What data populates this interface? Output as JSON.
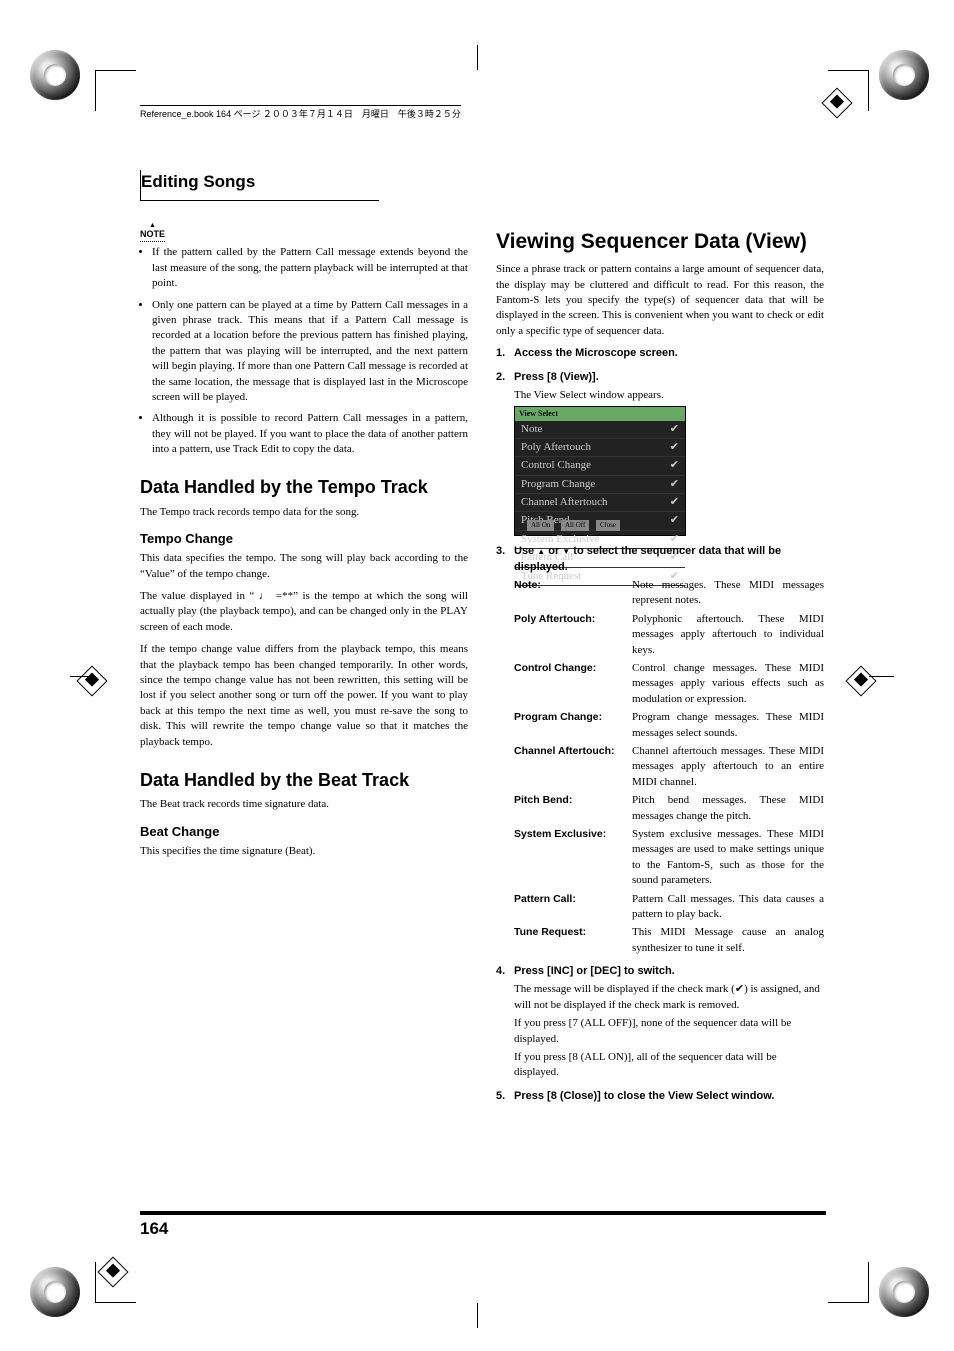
{
  "hint_top": "Reference_e.book  164 ページ  ２００３年７月１４日　月曜日　午後３時２５分",
  "header": {
    "title": "Editing Songs"
  },
  "left": {
    "note_label": "NOTE",
    "bullets": [
      "If the pattern called by the Pattern Call message extends beyond the last measure of the song, the pattern playback will be interrupted at that point.",
      "Only one pattern can be played at a time by Pattern Call messages in a given phrase track. This means that if a Pattern Call message is recorded at a location before the previous pattern has finished playing, the pattern that was playing will be interrupted, and the next pattern will begin playing. If more than one Pattern Call message is recorded at the same location, the message that is displayed last in the Microscope screen will be played.",
      "Although it is possible to record Pattern Call messages in a pattern, they will not be played. If you want to place the data of another pattern into a pattern, use Track Edit to copy the data."
    ],
    "h2a": "Data Handled by the Tempo Track",
    "p_a": "The Tempo track records tempo data for the song.",
    "h3a": "Tempo Change",
    "p_b": "This data specifies the tempo. The song will play back according to the “Value” of the tempo change.",
    "p_c1": "The value displayed in “ ",
    "p_c2": " =**” is the tempo at which the song will actually play (the playback tempo), and can be changed only in the PLAY screen of each mode.",
    "p_d": "If the tempo change value differs from the playback tempo, this means that the playback tempo has been changed temporarily. In other words, since the tempo change value has not been rewritten, this setting will be lost if you select another song or turn off the power. If you want to play back at this tempo the next time as well, you must re-save the song to disk. This will rewrite the tempo change value so that it matches the playback tempo.",
    "h2b": "Data Handled by the Beat Track",
    "p_e": "The Beat track records time signature data.",
    "h3b": "Beat Change",
    "p_f": "This specifies the time signature (Beat)."
  },
  "right": {
    "h2": "Viewing Sequencer Data (View)",
    "intro": "Since a phrase track or pattern contains a large amount of sequencer data, the display may be cluttered and difficult to read. For this reason, the Fantom-S lets you specify the type(s) of sequencer data that will be displayed in the screen. This is convenient when you want to check or edit only a specific type of sequencer data.",
    "steps": {
      "s1": "Access the Microscope screen.",
      "s2": "Press [8 (View)].",
      "s2_sub": "The View Select window appears.",
      "s3_a": "Use ",
      "s3_b": " or ",
      "s3_c": " to select the sequencer data that will be displayed.",
      "s4": "Press [INC] or [DEC] to switch.",
      "s4_sub_a": "The message will be displayed if the check mark (",
      "s4_sub_b": ") is assigned, and will not be displayed if the check mark is removed.",
      "s4_sub2": "If you press [7 (ALL OFF)], none of the sequencer data will be displayed.",
      "s4_sub3": "If you press [8 (ALL ON)], all of the sequencer data will be displayed.",
      "s5": "Press [8 (Close)] to close the View Select window."
    },
    "view_window": {
      "title": "View Select",
      "items": [
        "Note",
        "Poly Aftertouch",
        "Control Change",
        "Program Change",
        "Channel Aftertouch",
        "Pitch Bend",
        "System Exclusive",
        "Pattern Call",
        "Tune Request"
      ],
      "btn_on": "All On",
      "btn_off": "All Off",
      "btn_close": "Close"
    },
    "kv": [
      {
        "label": "Note:",
        "val": "Note messages. These MIDI messages represent notes."
      },
      {
        "label": "Poly Aftertouch:",
        "val": "Polyphonic aftertouch. These MIDI messages apply aftertouch to individual keys."
      },
      {
        "label": "Control Change:",
        "val": "Control change messages. These MIDI messages apply various effects such as modulation or expression."
      },
      {
        "label": "Program Change:",
        "val": "Program change messages. These MIDI messages select sounds."
      },
      {
        "label": "Channel Aftertouch:",
        "val": "Channel aftertouch messages. These MIDI messages apply aftertouch to an entire MIDI channel."
      },
      {
        "label": "Pitch Bend:",
        "val": "Pitch bend messages. These MIDI messages change the pitch."
      },
      {
        "label": "System Exclusive:",
        "val": "System exclusive messages. These MIDI messages are used to make settings unique to the Fantom-S, such as those for the sound parameters."
      },
      {
        "label": "Pattern Call:",
        "val": "Pattern Call messages. This data causes a pattern to play back."
      },
      {
        "label": "Tune Request:",
        "val": "This MIDI Message cause an analog synthesizer to tune it self."
      }
    ]
  },
  "page_number": "164"
}
